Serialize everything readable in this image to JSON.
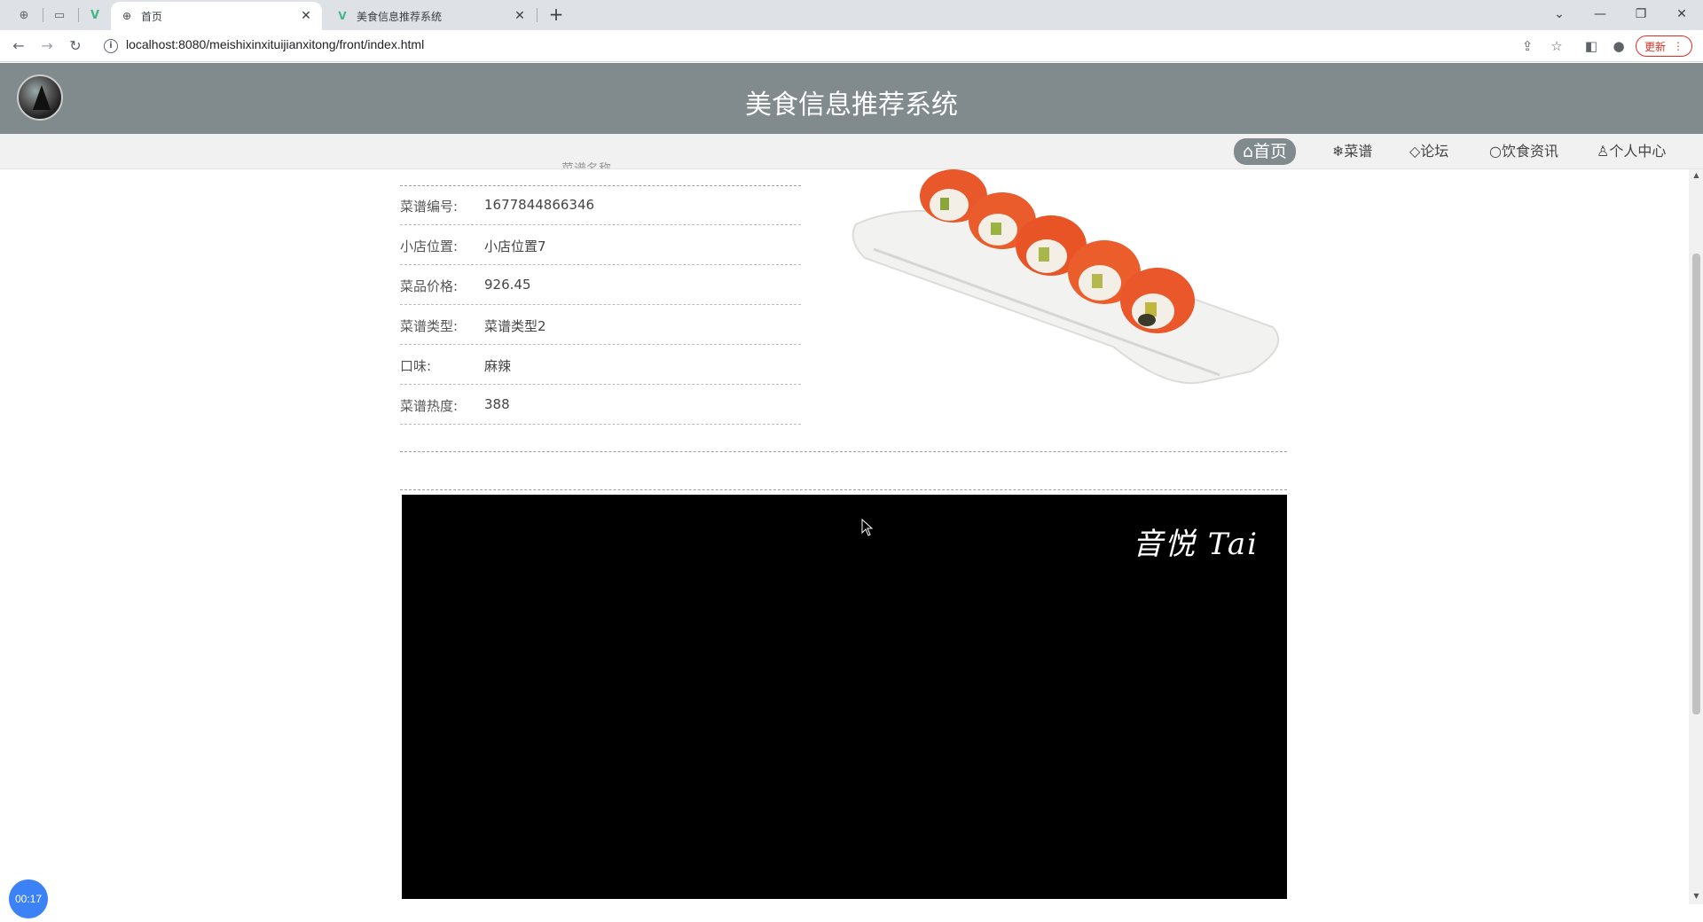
{
  "browser": {
    "tabs": [
      {
        "title": "首页",
        "active": true
      },
      {
        "title": "美食信息推荐系统",
        "active": false
      }
    ],
    "url": "localhost:8080/meishixinxituijianxitong/front/index.html",
    "update_label": "更新"
  },
  "site": {
    "title": "美食信息推荐系统",
    "nav": [
      "⌂首页",
      "❄菜谱",
      "◇论坛",
      "○饮食资讯",
      "♙个人中心"
    ]
  },
  "detail": {
    "partial_heading": "菜谱名称",
    "rows": [
      {
        "label": "菜谱编号:",
        "value": "1677844866346"
      },
      {
        "label": "小店位置:",
        "value": "小店位置7"
      },
      {
        "label": "菜品价格:",
        "value": "926.45"
      },
      {
        "label": "菜谱类型:",
        "value": "菜谱类型2"
      },
      {
        "label": "口味:",
        "value": "麻辣"
      },
      {
        "label": "菜谱热度:",
        "value": "388"
      }
    ]
  },
  "video": {
    "watermark": "音悦 Tai"
  },
  "recorder": {
    "time": "00:17"
  }
}
